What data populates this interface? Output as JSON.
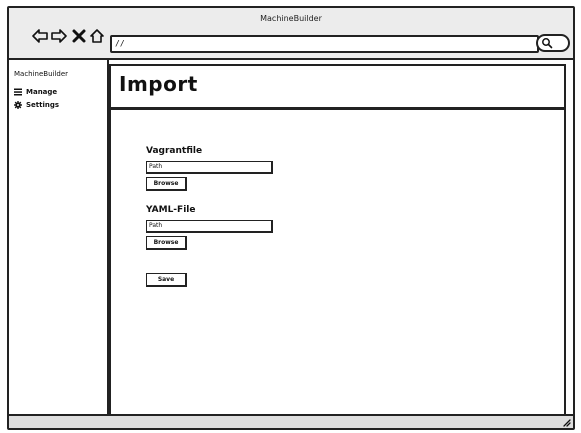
{
  "window": {
    "title": "MachineBuilder"
  },
  "browser": {
    "url": "//",
    "back_icon": "back-arrow-icon",
    "forward_icon": "forward-arrow-icon",
    "stop_icon": "close-icon",
    "home_icon": "home-icon",
    "search_icon": "search-icon"
  },
  "sidebar": {
    "brand": "MachineBuilder",
    "items": [
      {
        "label": "Manage",
        "icon": "menu-icon"
      },
      {
        "label": "Settings",
        "icon": "gear-icon"
      }
    ]
  },
  "header": {
    "title": "Import"
  },
  "form": {
    "vagrant": {
      "label": "Vagrantfile",
      "value": "Path",
      "button": "Browse"
    },
    "yaml": {
      "label": "YAML-File",
      "value": "Path",
      "button": "Browse"
    },
    "save_label": "Save"
  }
}
